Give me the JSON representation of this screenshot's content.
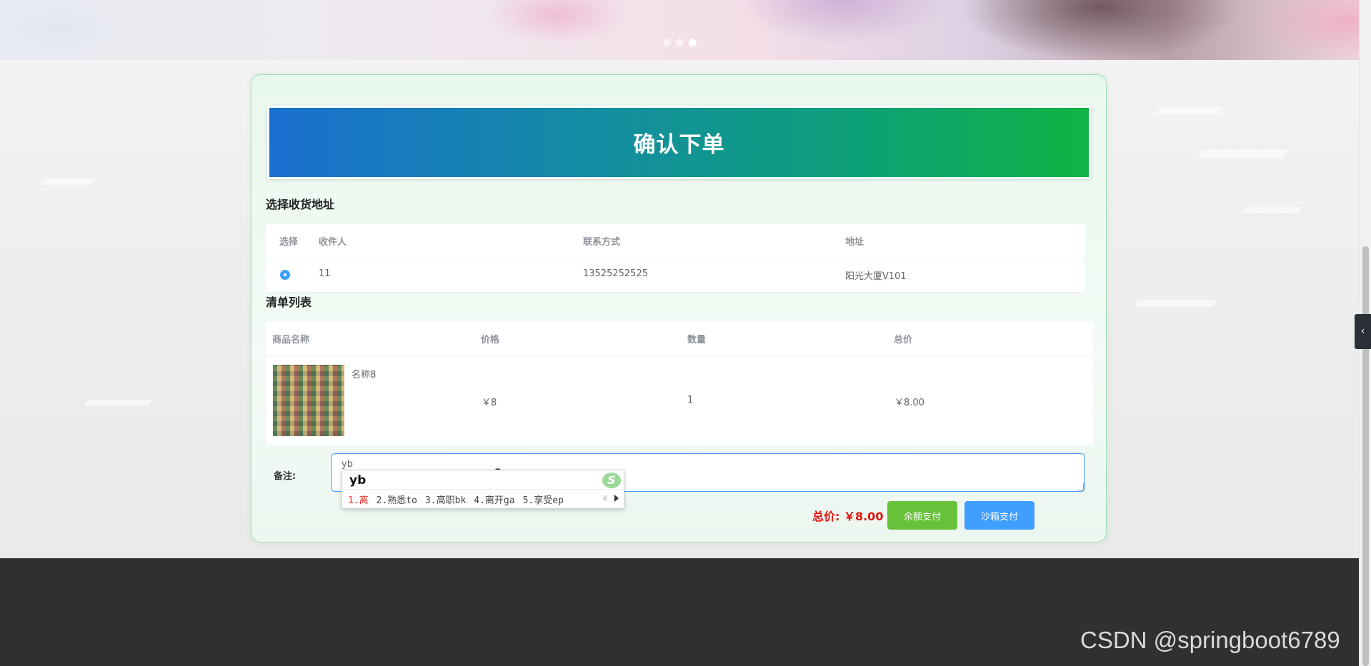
{
  "banner": {
    "carousel_dots": 3,
    "active_dot": 3
  },
  "order": {
    "title": "确认下单",
    "address_section": {
      "title": "选择收货地址",
      "columns": [
        "选择",
        "收件人",
        "联系方式",
        "地址"
      ],
      "rows": [
        {
          "selected": true,
          "recipient": "11",
          "phone": "13525252525",
          "address": "阳光大厦V101"
        }
      ]
    },
    "items_section": {
      "title": "清单列表",
      "columns": [
        "商品名称",
        "价格",
        "数量",
        "总价"
      ],
      "rows": [
        {
          "name": "名称8",
          "price": "￥8",
          "quantity": "1",
          "total": "￥8.00"
        }
      ]
    },
    "remark": {
      "label": "备注:",
      "value": "yb"
    },
    "ime": {
      "composition": "yb",
      "candidates": [
        "1.离",
        "2.熟悉to",
        "3.高职bk",
        "4.离开ga",
        "5.享受ep"
      ]
    },
    "total_text": "总价: ￥8.00",
    "buttons": {
      "balance_pay": "余额支付",
      "sandbox_pay": "沙箱支付"
    }
  },
  "watermark": "CSDN @springboot6789",
  "icons": {
    "ime_logo": "sogou-s-icon",
    "side_toggle": "chevron-left-icon"
  }
}
